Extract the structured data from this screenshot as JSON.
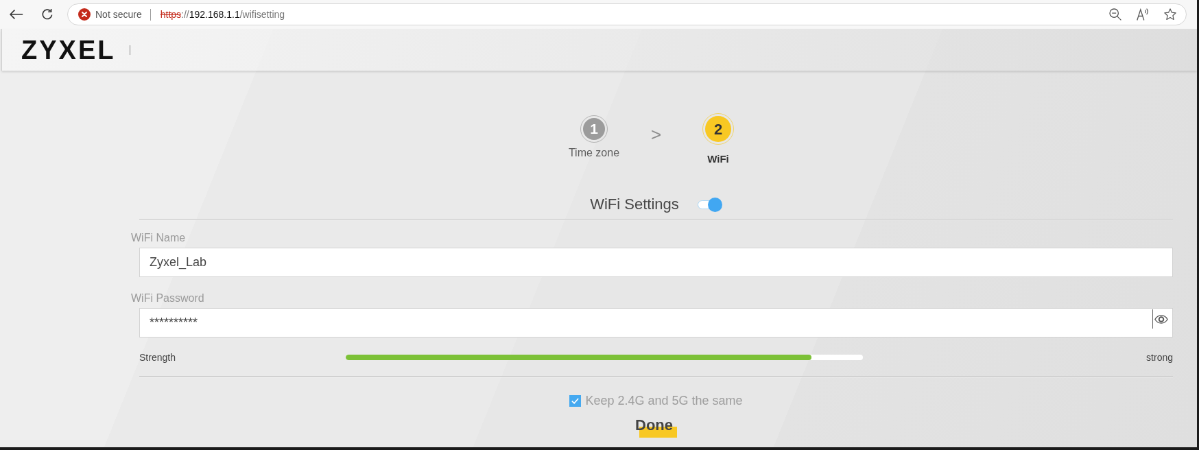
{
  "browser": {
    "security_label": "Not secure",
    "url": {
      "scheme": "https",
      "separator": "://",
      "host": "192.168.1.1",
      "path": "/wifisetting"
    }
  },
  "header": {
    "logo": "ZYXEL"
  },
  "steps": [
    {
      "number": "1",
      "label": "Time zone",
      "selected": false
    },
    {
      "number": "2",
      "label": "WiFi",
      "selected": true
    }
  ],
  "separators": [
    ">"
  ],
  "wifi_settings": {
    "title": "WiFi Settings",
    "on": true
  },
  "fields": [
    {
      "kind": "text",
      "label": "WiFi Name",
      "value": "Zyxel_Lab"
    },
    {
      "kind": "password",
      "label": "WiFi Password",
      "value": "**********"
    }
  ],
  "strength": {
    "label": "Strength",
    "level": 0.9,
    "reading": "strong"
  },
  "same_settings": {
    "label": "Keep 2.4G and 5G the same",
    "checked": true
  },
  "done_button": {
    "label": "Done"
  }
}
